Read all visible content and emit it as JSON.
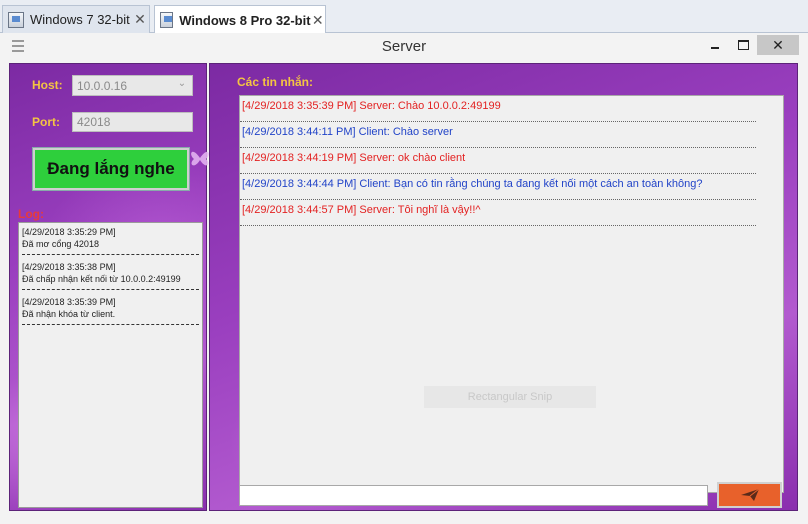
{
  "host_tabs": [
    {
      "label": "Windows 7 32-bit",
      "close": "✕"
    },
    {
      "label": "Windows 8 Pro 32-bit",
      "close": "✕"
    }
  ],
  "window": {
    "title": "Server",
    "controls": {
      "close": "✕"
    }
  },
  "connection": {
    "host_label": "Host:",
    "host_value": "10.0.0.16",
    "port_label": "Port:",
    "port_value": "42018",
    "listen_button": "Đang lắng nghe"
  },
  "log": {
    "label": "Log:",
    "entries": [
      {
        "time": "[4/29/2018 3:35:29 PM]",
        "text": "Đã mơ cổng 42018"
      },
      {
        "time": "[4/29/2018 3:35:38 PM]",
        "text": "Đã chấp nhận kết nối từ 10.0.0.2:49199"
      },
      {
        "time": "[4/29/2018 3:35:39 PM]",
        "text": "Đã nhận khóa từ client."
      }
    ]
  },
  "messages": {
    "label": "Các tin nhắn:",
    "items": [
      {
        "text": "[4/29/2018 3:35:39 PM] Server: Chào 10.0.0.2:49199",
        "sender": "server"
      },
      {
        "text": "[4/29/2018 3:44:11 PM] Client: Chào server",
        "sender": "client"
      },
      {
        "text": "[4/29/2018 3:44:19 PM] Server: ok chào client",
        "sender": "server"
      },
      {
        "text": "[4/29/2018 3:44:44 PM] Client: Bạn có tin rằng chúng ta đang kết nối một cách an toàn không?",
        "sender": "client"
      },
      {
        "text": "[4/29/2018 3:44:57 PM] Server: Tôi nghĩ là vậy!!^",
        "sender": "server"
      }
    ],
    "overlay_text": "Rectangular Snip"
  },
  "compose": {
    "input_value": "",
    "send_icon": "send-icon"
  },
  "colors": {
    "server_text": "#e32222",
    "client_text": "#2244c8",
    "accent_label": "#f4c542",
    "listen_button": "#2ecf3c",
    "send_button": "#e8612b"
  }
}
